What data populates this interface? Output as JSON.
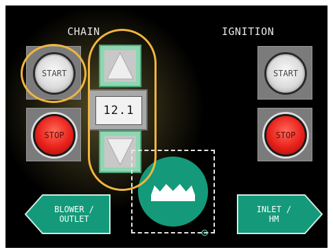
{
  "chain": {
    "title": "CHAIN",
    "start_label": "START",
    "stop_label": "STOP",
    "value": "12.1"
  },
  "ignition": {
    "title": "IGNITION",
    "start_label": "START",
    "stop_label": "STOP"
  },
  "nav": {
    "left_label": "BLOWER /\nOUTLET",
    "right_label": "INLET /\nHM"
  },
  "icons": {
    "up": "triangle-up-icon",
    "down": "triangle-down-icon",
    "logo": "crown-logo-icon"
  },
  "colors": {
    "accent_green": "#149a7a",
    "highlight": "#f2b640",
    "stop_red": "#e8201a"
  }
}
